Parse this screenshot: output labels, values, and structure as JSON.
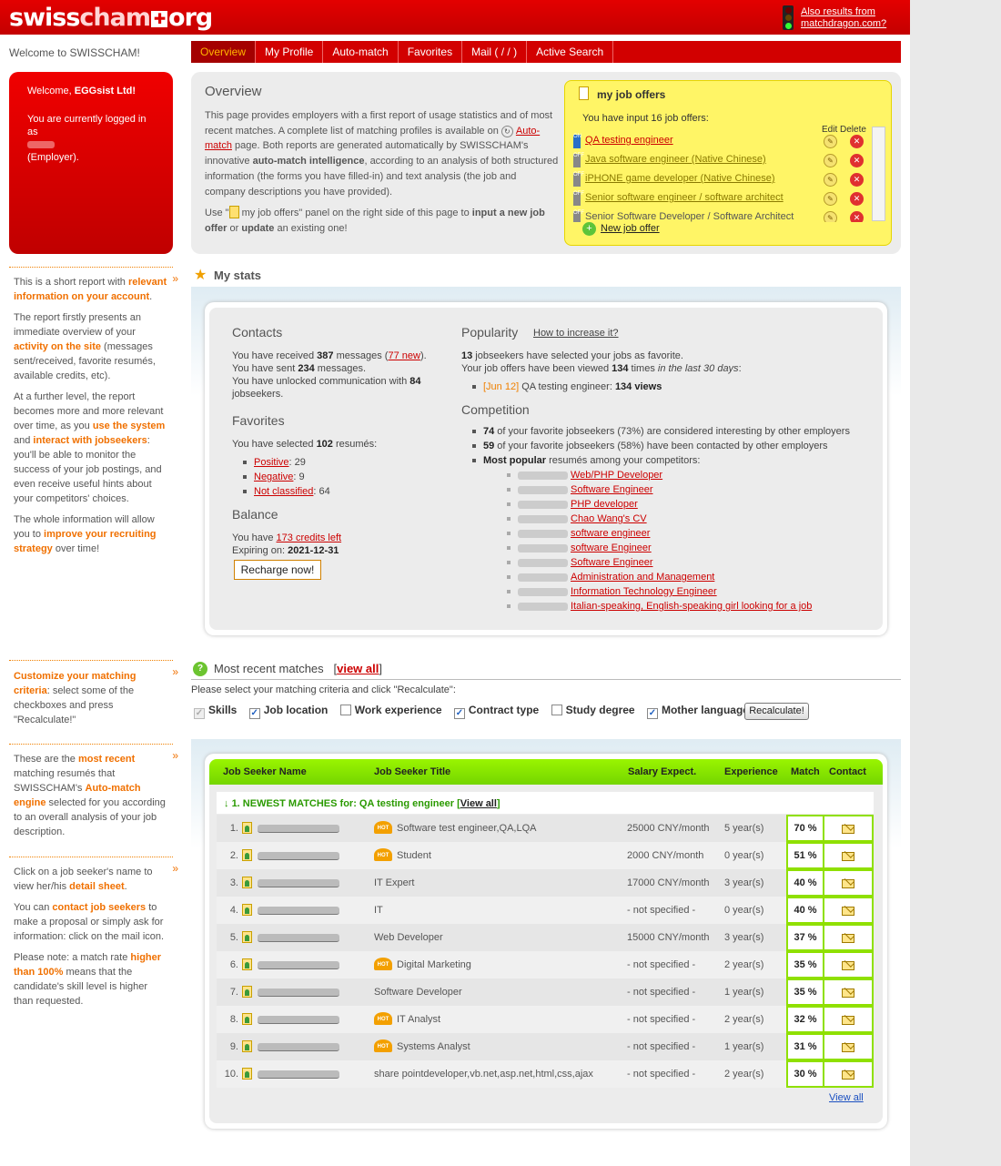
{
  "header": {
    "logo_left": "swiss",
    "logo_right": "cham",
    "logo_tld": "org",
    "also_line1": "Also results from",
    "also_line2": "matchdragon.com?"
  },
  "welcome_top": "Welcome to SWISSCHAM!",
  "nav": [
    {
      "label": "Overview",
      "active": true
    },
    {
      "label": "My Profile"
    },
    {
      "label": "Auto-match"
    },
    {
      "label": "Favorites"
    },
    {
      "label": "Mail ( / / )"
    },
    {
      "label": "Active Search"
    }
  ],
  "welcome_box": {
    "greeting_prefix": "Welcome, ",
    "company": "EGGsist Ltd!",
    "logged_line": "You are currently logged in as",
    "role": "(Employer)."
  },
  "sidebar": {
    "b1": {
      "p1a": "This is a short report with ",
      "p1b": "relevant information on your account",
      "p1c": ".",
      "p2a": "The report firstly presents an immediate overview of your ",
      "p2b": "activity on the site",
      "p2c": " (messages sent/received, favorite resumés, available credits, etc).",
      "p3a": "At a further level, the report becomes more and more relevant over time, as you ",
      "p3b": "use the system",
      "p3c": " and ",
      "p3d": "interact with jobseekers",
      "p3e": ": you'll be able to monitor the success of your job postings, and even receive useful hints about your competitors' choices.",
      "p4a": "The whole information will allow you to ",
      "p4b": "improve your recruiting strategy",
      "p4c": " over time!"
    },
    "b2": {
      "a": "Customize your matching criteria",
      "b": ": select some of the checkboxes and press \"Recalculate!\""
    },
    "b3": {
      "a": "These are the ",
      "b": "most recent",
      "c": " matching resumés that SWISSCHAM's ",
      "d": "Auto-match engine",
      "e": " selected for you according to an overall analysis of your job description."
    },
    "b4": {
      "p1a": "Click on a job seeker's name to view her/his ",
      "p1b": "detail sheet",
      "p1c": ".",
      "p2a": "You can ",
      "p2b": "contact job seekers",
      "p2c": " to make a proposal or simply ask for information: click on the mail icon.",
      "p3a": "Please note: a match rate ",
      "p3b": "higher than 100%",
      "p3c": " means that the candidate's skill level is higher than requested."
    }
  },
  "overview": {
    "title": "Overview",
    "t1": "This page provides employers with a first report of usage statistics and of most recent matches. A complete list of matching profiles is available on ",
    "link": "Auto-match",
    "t2": " page. Both reports are generated automatically by SWISSCHAM's innovative ",
    "t2b": "auto-match intelligence",
    "t3": ", according to an analysis of both structured information (the forms you have filled-in) and text analysis (the job and company descriptions you have provided).",
    "u1": "Use \"",
    "u2": " my job offers\" panel on the right side of this page to ",
    "u3": "input a new job offer",
    "u4": " or ",
    "u5": "update",
    "u6": " an existing one!"
  },
  "job_offers": {
    "title": "my job offers",
    "subtitle": "You have input 16 job offers:",
    "edit": "Edit",
    "delete": "Delete",
    "new": "New job offer",
    "items": [
      {
        "title": "QA testing engineer",
        "on": true
      },
      {
        "title": "Java software engineer (Native Chinese)",
        "on": false
      },
      {
        "title": "iPHONE game developer (Native Chinese)",
        "on": false
      },
      {
        "title": "Senior software engineer / software architect",
        "on": false
      },
      {
        "title": "Senior Software Developer / Software Architect",
        "on": false
      }
    ]
  },
  "stats": {
    "title": "My stats",
    "contacts": {
      "title": "Contacts",
      "r1": "You have received ",
      "n1": "387",
      "r2": " messages (",
      "new": "77 new",
      "r3": ").",
      "s1": "You have sent ",
      "n2": "234",
      "s2": " messages.",
      "u1": "You have unlocked communication with ",
      "n3": "84",
      "u2": "jobseekers."
    },
    "favorites": {
      "title": "Favorites",
      "s1": "You have selected ",
      "n": "102",
      "s2": " resumés:",
      "items": [
        {
          "label": "Positive",
          "count": ": 29"
        },
        {
          "label": "Negative",
          "count": ": 9"
        },
        {
          "label": "Not classified",
          "count": ": 64"
        }
      ]
    },
    "balance": {
      "title": "Balance",
      "s1": "You have ",
      "credits": "173 credits left",
      "s2": "Expiring on: ",
      "date": "2021-12-31",
      "recharge": "Recharge now!"
    },
    "popularity": {
      "title": "Popularity",
      "link": "How to increase it?",
      "n1": "13",
      "l1": " jobseekers have selected your jobs as favorite.",
      "l2a": "Your job offers have been viewed ",
      "n2": "134",
      "l2b": " times ",
      "l2c": "in the last 30 days",
      "l2d": ":",
      "date": "[Jun 12]",
      "job": " QA testing engineer: ",
      "views": "134 views"
    },
    "competition": {
      "title": "Competition",
      "c1n": "74",
      "c1": " of your favorite jobseekers (73%) are considered interesting by other employers",
      "c2n": "59",
      "c2": " of your favorite jobseekers (58%) have been contacted by other employers",
      "c3a": "Most popular",
      "c3b": " resumés among your competitors:",
      "popular": [
        "Web/PHP Developer",
        "Software Engineer",
        "PHP developer",
        "Chao Wang's CV",
        "software engineer",
        "software Engineer",
        "Software Engineer",
        "Administration and Management",
        "Information Technology Engineer",
        "Italian-speaking, English-speaking girl looking for a job"
      ]
    }
  },
  "matches": {
    "title": "Most recent matches",
    "view_all": "view all",
    "instr": "Please select your matching criteria and click \"Recalculate\":",
    "criteria": [
      {
        "label": "Skills",
        "checked": true,
        "disabled": true
      },
      {
        "label": "Job location",
        "checked": true
      },
      {
        "label": "Work experience",
        "checked": false
      },
      {
        "label": "Contract type",
        "checked": true
      },
      {
        "label": "Study degree",
        "checked": false
      },
      {
        "label": "Mother language",
        "checked": true
      }
    ],
    "recalc": "Recalculate!",
    "cols": [
      "Job Seeker Name",
      "Job Seeker Title",
      "Salary Expect.",
      "Experience",
      "Match",
      "Contact"
    ],
    "newest_prefix": "1. NEWEST MATCHES for: QA testing engineer ",
    "newest_link": "View all",
    "rows": [
      {
        "rank": "1.",
        "hot": true,
        "title": "Software test engineer,QA,LQA",
        "salary": "25000 CNY/month",
        "exp": "5 year(s)",
        "match": "70 %"
      },
      {
        "rank": "2.",
        "hot": true,
        "title": "Student",
        "salary": "2000 CNY/month",
        "exp": "0 year(s)",
        "match": "51 %"
      },
      {
        "rank": "3.",
        "hot": false,
        "title": "IT Expert",
        "salary": "17000 CNY/month",
        "exp": "3 year(s)",
        "match": "40 %"
      },
      {
        "rank": "4.",
        "hot": false,
        "title": "IT",
        "salary": "- not specified -",
        "exp": "0 year(s)",
        "match": "40 %"
      },
      {
        "rank": "5.",
        "hot": false,
        "title": "Web Developer",
        "salary": "15000 CNY/month",
        "exp": "3 year(s)",
        "match": "37 %"
      },
      {
        "rank": "6.",
        "hot": true,
        "title": "Digital Marketing",
        "salary": "- not specified -",
        "exp": "2 year(s)",
        "match": "35 %"
      },
      {
        "rank": "7.",
        "hot": false,
        "title": "Software Developer",
        "salary": "- not specified -",
        "exp": "1 year(s)",
        "match": "35 %"
      },
      {
        "rank": "8.",
        "hot": true,
        "title": "IT Analyst",
        "salary": "- not specified -",
        "exp": "2 year(s)",
        "match": "32 %"
      },
      {
        "rank": "9.",
        "hot": true,
        "title": "Systems Analyst",
        "salary": "- not specified -",
        "exp": "1 year(s)",
        "match": "31 %"
      },
      {
        "rank": "10.",
        "hot": false,
        "title": "share pointdeveloper,vb.net,asp.net,html,css,ajax",
        "salary": "- not specified -",
        "exp": "2 year(s)",
        "match": "30 %"
      }
    ],
    "bottom_link": "View all"
  }
}
